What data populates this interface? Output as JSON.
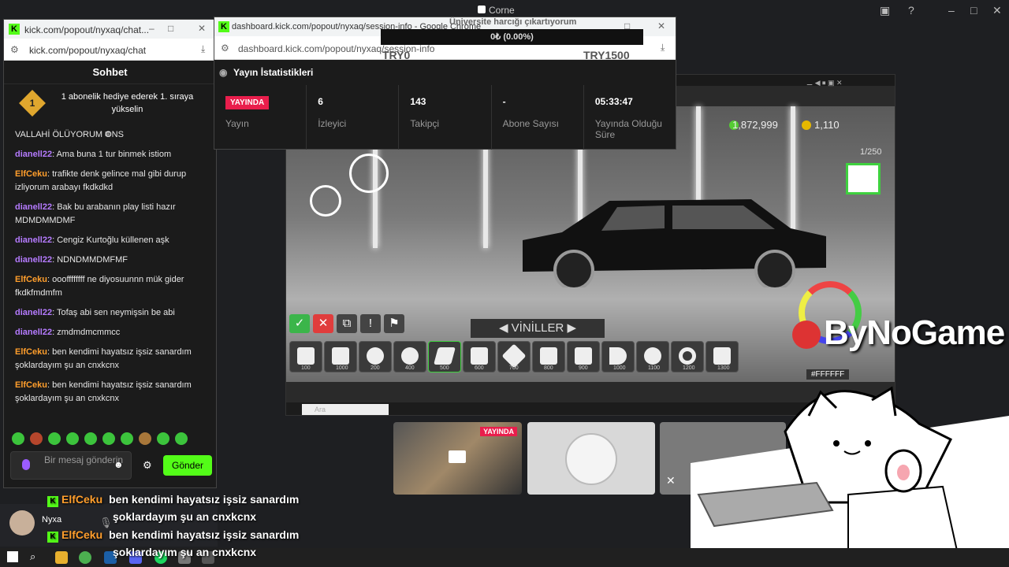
{
  "discord": {
    "window_title": "Corne",
    "username": "Nyxa"
  },
  "donation": {
    "title": "Üniversite harcığı çıkartıyorum",
    "progress_text": "0₺ (0.00%)",
    "min_label": "TRY0",
    "max_label": "TRY1500"
  },
  "chat_window": {
    "tab_title": "kick.com/popout/nyxaq/chat...",
    "url": "kick.com/popout/nyxaq/chat",
    "header": "Sohbet",
    "pinned_badge": "1",
    "pinned_text": "1 abonelik hediye ederek 1. sıraya yükselin",
    "messages": [
      {
        "user": "",
        "text": "VALLAHİ ÖLÜYORUM ONS",
        "color": "none"
      },
      {
        "user": "dianell22",
        "text": "Ama buna 1 tur binmek istiom",
        "color": "purple"
      },
      {
        "user": "ElfCeku",
        "text": "trafikte denk gelince mal gibi durup izliyorum arabayı fkdkdkd",
        "color": "orange"
      },
      {
        "user": "dianell22",
        "text": "Bak bu arabanın play listi hazır MDMDMMDMF",
        "color": "purple"
      },
      {
        "user": "dianell22",
        "text": "Cengiz Kurtoğlu küllenen aşk",
        "color": "purple"
      },
      {
        "user": "dianell22",
        "text": "NDNDMMDMFMF",
        "color": "purple"
      },
      {
        "user": "ElfCeku",
        "text": "oooffffffff ne diyosuunnn mük gider fkdkfmdmfm",
        "color": "orange"
      },
      {
        "user": "dianell22",
        "text": "Tofaş abi sen neymişsin be abi",
        "color": "purple"
      },
      {
        "user": "dianell22",
        "text": "zmdmdmcmmcc",
        "color": "purple"
      },
      {
        "user": "ElfCeku",
        "text": "ben kendimi hayatsız işsiz sanardım şoklardayım şu an cnxkcnx",
        "color": "orange"
      },
      {
        "user": "ElfCeku",
        "text": "ben kendimi hayatsız işsiz sanardım şoklardayım şu an cnxkcnx",
        "color": "orange"
      }
    ],
    "input_placeholder": "Bir mesaj gönderin",
    "send_label": "Gönder"
  },
  "dashboard_window": {
    "tab_title": "dashboard.kick.com/popout/nyxaq/session-info - Google Chrome",
    "url": "dashboard.kick.com/popout/nyxaq/session-info",
    "header": "Yayın İstatistikleri",
    "stats": [
      {
        "value": "YAYINDA",
        "label": "Yayın"
      },
      {
        "value": "6",
        "label": "İzleyici"
      },
      {
        "value": "143",
        "label": "Takipçi"
      },
      {
        "value": "-",
        "label": "Abone Sayısı"
      },
      {
        "value": "05:33:47",
        "label": "Yayında Olduğu Süre"
      }
    ]
  },
  "game": {
    "money": "1,872,999",
    "gold": "1,110",
    "counter": "1/250",
    "menu_label": "VİNİLLER",
    "color_hex": "#FFFFFF",
    "shape_prices": [
      "100",
      "1000",
      "200",
      "400",
      "500",
      "600",
      "700",
      "800",
      "900",
      "1000",
      "1100",
      "1200",
      "1300"
    ],
    "search_placeholder": "Ara"
  },
  "logo_text": "ByNoGame",
  "thumbnail_live": "YAYINDA",
  "overlay_chat": [
    {
      "user": "ElfCeku",
      "line1": "ben kendimi hayatsız işsiz sanardım",
      "line2": "şoklardayım şu an cnxkcnx"
    },
    {
      "user": "ElfCeku",
      "line1": "ben kendimi hayatsız işsiz sanardım",
      "line2": "şoklardayım şu an cnxkcnx"
    }
  ]
}
